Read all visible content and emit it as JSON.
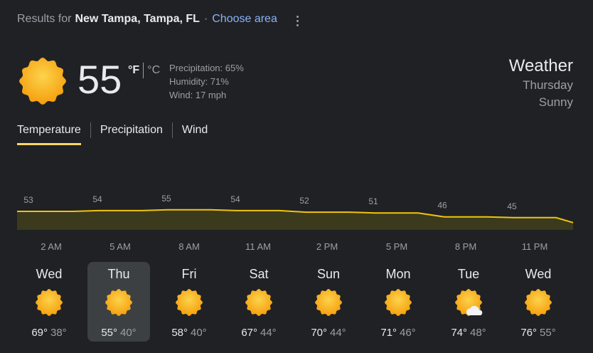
{
  "header": {
    "results_for": "Results for",
    "location": "New Tampa, Tampa, FL",
    "separator": "·",
    "choose_area": "Choose area"
  },
  "current": {
    "temp": "55",
    "unit_f": "°F",
    "unit_c": "°C",
    "precipitation": "Precipitation: 65%",
    "humidity": "Humidity: 71%",
    "wind": "Wind: 17 mph",
    "icon": "sunny-icon"
  },
  "title": {
    "weather": "Weather",
    "day": "Thursday",
    "condition": "Sunny"
  },
  "tabs": [
    "Temperature",
    "Precipitation",
    "Wind"
  ],
  "colors": {
    "accent": "#fdd663",
    "line": "#f1c40f",
    "area_fill": "#3b3a1c",
    "sun": "#fbbc04",
    "link": "#8ab4f8"
  },
  "chart_data": {
    "type": "area",
    "x": [
      "2 AM",
      "5 AM",
      "8 AM",
      "11 AM",
      "2 PM",
      "5 PM",
      "8 PM",
      "11 PM"
    ],
    "values": [
      53,
      54,
      55,
      54,
      52,
      51,
      46,
      45
    ],
    "labels": [
      "53",
      "54",
      "55",
      "54",
      "52",
      "51",
      "46",
      "45"
    ],
    "title": "",
    "xlabel": "",
    "ylabel": "",
    "grid": false,
    "legend": "none"
  },
  "forecast": [
    {
      "day": "Wed",
      "hi": "69°",
      "lo": "38°",
      "icon": "sunny-icon"
    },
    {
      "day": "Thu",
      "hi": "55°",
      "lo": "40°",
      "icon": "sunny-icon",
      "selected": true
    },
    {
      "day": "Fri",
      "hi": "58°",
      "lo": "40°",
      "icon": "sunny-icon"
    },
    {
      "day": "Sat",
      "hi": "67°",
      "lo": "44°",
      "icon": "sunny-icon"
    },
    {
      "day": "Sun",
      "hi": "70°",
      "lo": "44°",
      "icon": "sunny-icon"
    },
    {
      "day": "Mon",
      "hi": "71°",
      "lo": "46°",
      "icon": "sunny-icon"
    },
    {
      "day": "Tue",
      "hi": "74°",
      "lo": "48°",
      "icon": "partly-cloudy-icon"
    },
    {
      "day": "Wed",
      "hi": "76°",
      "lo": "55°",
      "icon": "sunny-icon"
    }
  ]
}
